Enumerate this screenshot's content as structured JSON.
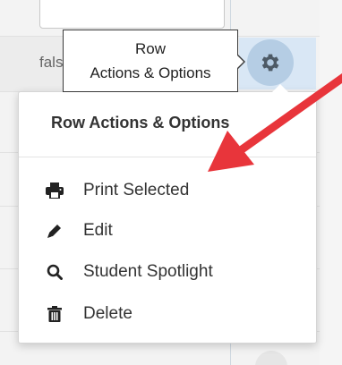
{
  "row": {
    "value_text": "false"
  },
  "tooltip": {
    "line1": "Row",
    "line2": "Actions & Options"
  },
  "menu": {
    "header": "Row Actions & Options",
    "items": [
      {
        "label": "Print Selected",
        "icon": "print-icon"
      },
      {
        "label": "Edit",
        "icon": "pencil-icon"
      },
      {
        "label": "Student Spotlight",
        "icon": "search-icon"
      },
      {
        "label": "Delete",
        "icon": "trash-icon"
      }
    ]
  },
  "colors": {
    "annotation_arrow": "#e8353b",
    "gear_button": "#b5cde4",
    "text_primary": "#333333"
  }
}
